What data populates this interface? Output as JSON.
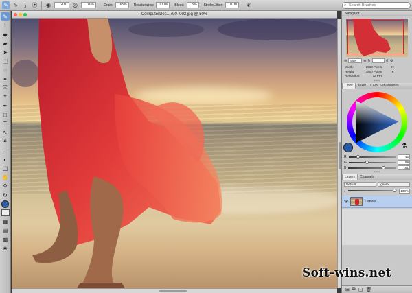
{
  "property_bar": {
    "size": "20.0",
    "opacity": "70%",
    "grain_label": "Grain:",
    "grain": "65%",
    "resaturation_label": "Resaturation:",
    "resaturation": "100%",
    "bleed_label": "Bleed:",
    "bleed": "5%",
    "jitter_label": "Stroke Jitter:",
    "jitter": "0.00",
    "search_placeholder": "Search Brushes"
  },
  "document": {
    "title": "ComputerDes...790_002.jpg @ 50%"
  },
  "navigator": {
    "title": "Navigator",
    "zoom": "50%",
    "width_label": "Width:",
    "width": "2560 Pixels",
    "height_label": "Height:",
    "height": "1800 Pixels",
    "resolution_label": "Resolution:",
    "resolution": "72 PPI",
    "x_label": "X:",
    "y_label": "Y:"
  },
  "color_panel": {
    "tabs": [
      "Color",
      "Mixer",
      "Color Set Libraries"
    ],
    "r_label": "R",
    "g_label": "G",
    "b_label": "B",
    "r": "42",
    "g": "89",
    "b": "181",
    "main_color": "#2a59b5"
  },
  "layers_panel": {
    "tabs": [
      "Layers",
      "Channels"
    ],
    "composite": "Default",
    "method": "Ignore",
    "opacity": "100%",
    "layer_name": "Canvas"
  },
  "watermark": "Soft-wins.net"
}
